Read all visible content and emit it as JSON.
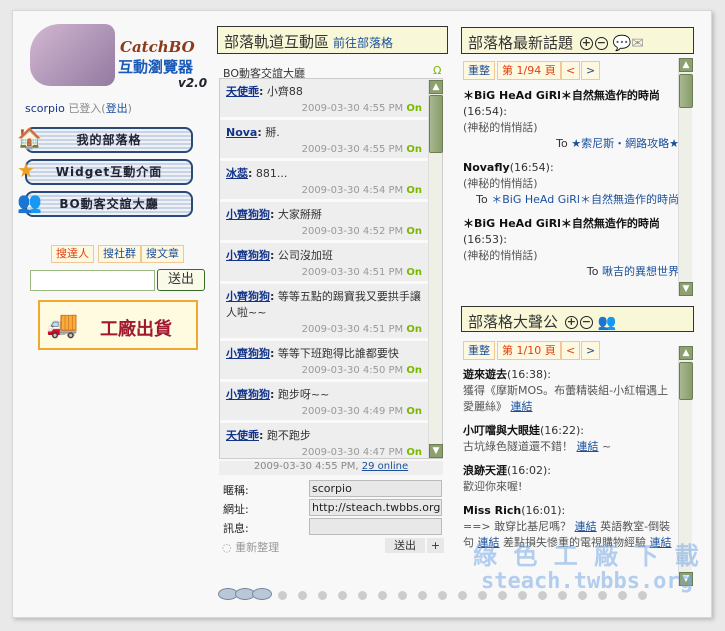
{
  "logo": {
    "brand": "CatchBO",
    "title": "互動瀏覽器",
    "version": "v2.0"
  },
  "user": {
    "name": "scorpio",
    "status": "已登入(",
    "logout": "登出",
    ")": ")"
  },
  "nav": [
    {
      "label": "我的部落格",
      "icon": "house-icon"
    },
    {
      "label": "Widget互動介面",
      "icon": "star-icon"
    },
    {
      "label": "BO動客交誼大廳",
      "icon": "people-icon"
    }
  ],
  "search": {
    "tabs": [
      "搜達人",
      "搜社群",
      "搜文章"
    ],
    "value": "",
    "submit": "送出"
  },
  "banner": {
    "label": "工廠出貨"
  },
  "chat": {
    "header": "部落軌道互動區",
    "header_link": "前往部落格",
    "room": "BO動客交誼大廳",
    "omega": "Ω",
    "messages": [
      {
        "user": "天使乖",
        "text": "小齊88",
        "time": "2009-03-30 4:55 PM",
        "status": "On"
      },
      {
        "user": "Nova",
        "text": "掰.",
        "time": "2009-03-30 4:55 PM",
        "status": "On"
      },
      {
        "user": "冰蕊",
        "text": "881...",
        "time": "2009-03-30 4:54 PM",
        "status": "On"
      },
      {
        "user": "小齊狗狗",
        "text": "大家掰掰",
        "time": "2009-03-30 4:52 PM",
        "status": "On"
      },
      {
        "user": "小齊狗狗",
        "text": "公司沒加班",
        "time": "2009-03-30 4:51 PM",
        "status": "On"
      },
      {
        "user": "小齊狗狗",
        "text": "等等五點的踢寶我又要拱手讓人啦~~",
        "time": "2009-03-30 4:51 PM",
        "status": "On"
      },
      {
        "user": "小齊狗狗",
        "text": "等等下班跑得比誰都要快",
        "time": "2009-03-30 4:50 PM",
        "status": "On"
      },
      {
        "user": "小齊狗狗",
        "text": "跑步呀~~",
        "time": "2009-03-30 4:49 PM",
        "status": "On"
      },
      {
        "user": "天使乖",
        "text": "跑不跑步",
        "time": "2009-03-30 4:47 PM",
        "status": "On"
      }
    ],
    "status_time": "2009-03-30 4:55 PM,",
    "online": "29 online",
    "form": {
      "nick_label": "暱稱:",
      "nick": "scorpio",
      "url_label": "網址:",
      "url": "http://steach.twbbs.org",
      "msg_label": "訊息:",
      "msg": ""
    },
    "refresh": "重新整理",
    "send": "送出",
    "plus": "+"
  },
  "topics": {
    "header": "部落格最新話題",
    "reset": "重整",
    "page": "第 1/94 頁",
    "prev": "<",
    "next": ">",
    "items": [
      {
        "user": "＊BiG HeAd GiRl＊自然無造作的時尚",
        "time": "(16:54):",
        "text": "(神秘的悄悄話)",
        "to": "To",
        "target": "★索尼斯・網路攻略★"
      },
      {
        "user": "Novafly",
        "time": "(16:54):",
        "text": "(神秘的悄悄話)",
        "to": "To",
        "target": "＊BiG HeAd GiRl＊自然無造作的時尚"
      },
      {
        "user": "＊BiG HeAd GiRl＊自然無造作的時尚",
        "time": "(16:53):",
        "text": "(神秘的悄悄話)",
        "to": "To",
        "target": "啾吉的異想世界"
      }
    ]
  },
  "shout": {
    "header": "部落格大聲公",
    "reset": "重整",
    "page": "第 1/10 頁",
    "prev": "<",
    "next": ">",
    "items": [
      {
        "user": "遊來遊去",
        "time": "(16:38):",
        "text": "獲得《摩斯MOS。布蕾精裝組-小紅帽遇上愛麗絲》",
        "link": "連結"
      },
      {
        "user": "小叮噹與大眼娃",
        "time": "(16:22):",
        "text": "古坑綠色隧道還不錯！",
        "link": "連結",
        "after": "~"
      },
      {
        "user": "浪跡天涯",
        "time": "(16:02):",
        "text": "歡迎你來喔!"
      },
      {
        "user": "Miss Rich",
        "time": "(16:01):",
        "text": "==> 敢穿比基尼嗎？",
        "link": "連結",
        "text2": "英語教室-倒裝句",
        "link2": "連結",
        "text3": "差點損失慘重的電視購物經驗",
        "link3": "連結"
      }
    ]
  },
  "watermark": {
    "line1": "綠 色 工 廠 下 載",
    "line2": "steach.twbbs.org"
  }
}
